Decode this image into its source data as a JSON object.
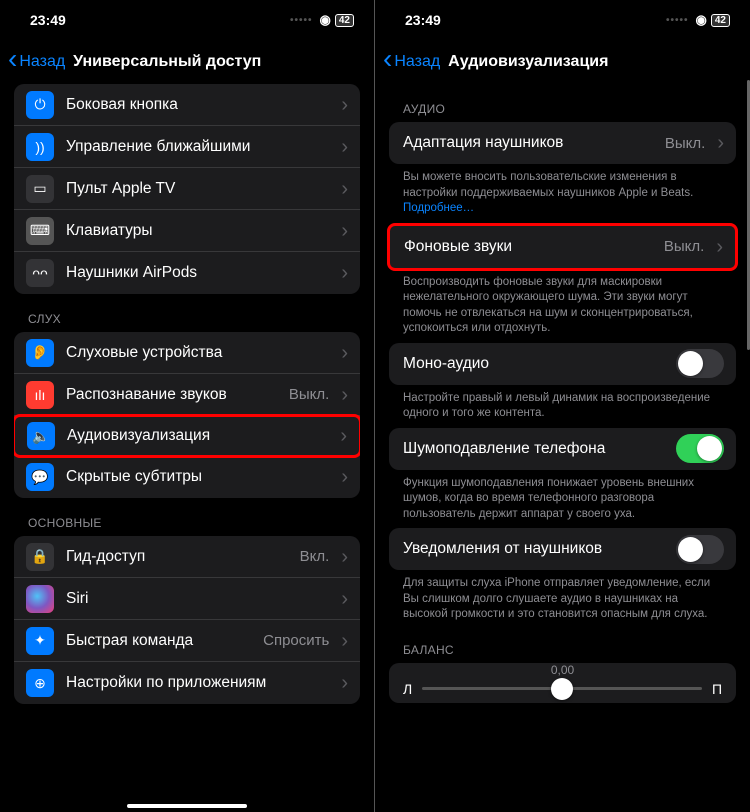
{
  "status": {
    "time": "23:49",
    "battery": "42"
  },
  "left": {
    "back": "Назад",
    "title": "Универсальный доступ",
    "top_rows": [
      {
        "label": "Боковая кнопка",
        "icon": "side-button-icon",
        "bg": "bg-blue",
        "glyph": "⏻"
      },
      {
        "label": "Управление ближайшими",
        "icon": "nearby-control-icon",
        "bg": "bg-blue",
        "glyph": "))"
      },
      {
        "label": "Пульт Apple TV",
        "icon": "appletv-remote-icon",
        "bg": "bg-dark",
        "glyph": "▭"
      },
      {
        "label": "Клавиатуры",
        "icon": "keyboards-icon",
        "bg": "bg-gray",
        "glyph": "⌨"
      },
      {
        "label": "Наушники AirPods",
        "icon": "airpods-icon",
        "bg": "bg-dark",
        "glyph": "ᴖᴖ"
      }
    ],
    "hearing_header": "СЛУХ",
    "hearing_rows": [
      {
        "label": "Слуховые устройства",
        "icon": "hearing-devices-icon",
        "bg": "bg-blue",
        "glyph": "👂"
      },
      {
        "label": "Распознавание звуков",
        "icon": "sound-recognition-icon",
        "bg": "bg-red",
        "glyph": "ılı",
        "value": "Выкл."
      },
      {
        "label": "Аудиовизуализация",
        "icon": "audio-visual-icon",
        "bg": "bg-blue",
        "glyph": "🔈",
        "highlight": true
      },
      {
        "label": "Скрытые субтитры",
        "icon": "subtitles-icon",
        "bg": "bg-blue",
        "glyph": "💬"
      }
    ],
    "general_header": "ОСНОВНЫЕ",
    "general_rows": [
      {
        "label": "Гид-доступ",
        "icon": "guided-access-icon",
        "bg": "bg-dark",
        "glyph": "🔒",
        "value": "Вкл."
      },
      {
        "label": "Siri",
        "icon": "siri-icon",
        "bg": "bg-siri",
        "glyph": ""
      },
      {
        "label": "Быстрая команда",
        "icon": "shortcut-icon",
        "bg": "bg-blue",
        "glyph": "✦",
        "value": "Спросить"
      },
      {
        "label": "Настройки по приложениям",
        "icon": "per-app-icon",
        "bg": "bg-blue",
        "glyph": "⊕"
      }
    ]
  },
  "right": {
    "back": "Назад",
    "title": "Аудиовизуализация",
    "audio_header": "АУДИО",
    "row_adapt": {
      "label": "Адаптация наушников",
      "value": "Выкл."
    },
    "adapt_footer_text": "Вы можете вносить пользовательские изменения в настройки поддерживаемых наушников Apple и Beats. ",
    "adapt_footer_link": "Подробнее…",
    "row_bg": {
      "label": "Фоновые звуки",
      "value": "Выкл."
    },
    "bg_footer": "Воспроизводить фоновые звуки для маскировки нежелательного окружающего шума. Эти звуки могут помочь не отвлекаться на шум и сконцентрироваться, успокоиться или отдохнуть.",
    "row_mono": {
      "label": "Моно-аудио"
    },
    "mono_footer": "Настройте правый и левый динамик на воспроизведение одного и того же контента.",
    "row_noise": {
      "label": "Шумоподавление телефона"
    },
    "noise_footer": "Функция шумоподавления понижает уровень внешних шумов, когда во время телефонного разговора пользователь держит аппарат у своего уха.",
    "row_notif": {
      "label": "Уведомления от наушников"
    },
    "notif_footer": "Для защиты слуха iPhone отправляет уведомление, если Вы слишком долго слушаете аудио в наушниках на высокой громкости и это становится опасным для слуха.",
    "balance_header": "БАЛАНС",
    "balance_left": "Л",
    "balance_right": "П",
    "balance_value": "0,00"
  }
}
